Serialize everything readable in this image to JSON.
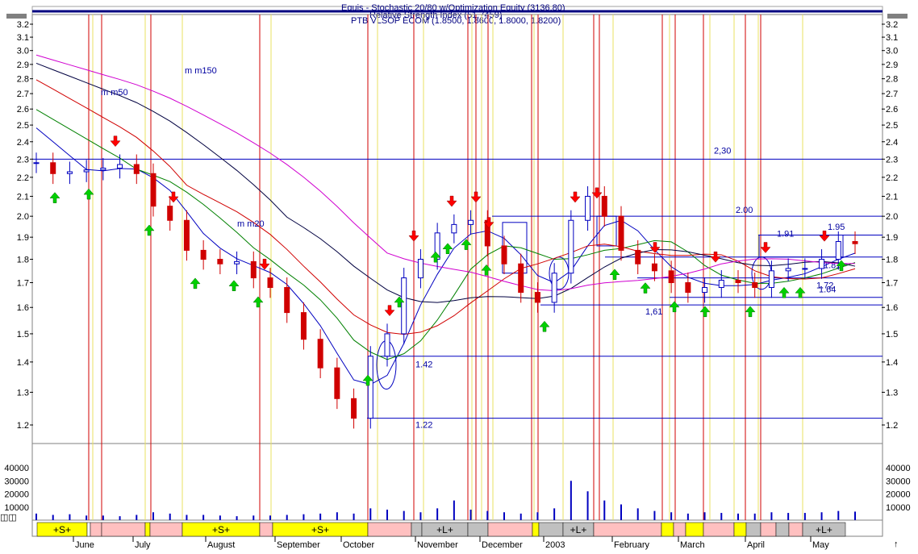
{
  "chart_data": {
    "type": "candlestick",
    "header": {
      "line1": "Equis - Stochastic 20/80 w/Optimization Equity (3136.80)",
      "line2": "Relative Strength Index (51.7459)",
      "line3": "PTB VLSOP ECOM (1.8500, 1.8600, 1.8000, 1.8200)"
    },
    "x_labels": [
      "June",
      "July",
      "August",
      "September",
      "October",
      "November",
      "December",
      "2003",
      "February",
      "March",
      "April",
      "May"
    ],
    "price_axis": {
      "ticks": [
        "3.2",
        "3.1",
        "3.0",
        "2.9",
        "2.8",
        "2.7",
        "2.6",
        "2.5",
        "2.4",
        "2.3",
        "2.2",
        "2.1",
        "2.0",
        "1.9",
        "1.8",
        "1.7",
        "1.6",
        "1.5",
        "1.4",
        "1.3",
        "1.2"
      ],
      "min": 1.15,
      "max": 3.25,
      "scale": "log"
    },
    "volume_axis": {
      "ticks": [
        "40000",
        "30000",
        "20000",
        "10000"
      ],
      "max": 45000
    },
    "horizontal_levels": [
      {
        "value": 2.3,
        "label": "2,30"
      },
      {
        "value": 2.0,
        "label": "2.00"
      },
      {
        "value": 1.91,
        "label": "1.91"
      },
      {
        "value": 1.81,
        "label": "1.81"
      },
      {
        "value": 1.72,
        "label": "1.72"
      },
      {
        "value": 1.64,
        "label": "1.64"
      },
      {
        "value": 1.61,
        "label": "1,61"
      },
      {
        "value": 1.42,
        "label": "1.42"
      },
      {
        "value": 1.22,
        "label": "1.22"
      }
    ],
    "level_1_95_label": "1.95",
    "ma_labels": {
      "mm150": "m m150",
      "mm50": "m m50",
      "mm20": "m m20"
    },
    "band_labels": [
      "+S+",
      "+S+",
      "+S+",
      "+L+",
      "+L+",
      "+L+"
    ],
    "dates": [
      "2002-06-03",
      "2002-06-10",
      "2002-06-17",
      "2002-06-24",
      "2002-07-01",
      "2002-07-08",
      "2002-07-15",
      "2002-07-22",
      "2002-07-29",
      "2002-08-05",
      "2002-08-12",
      "2002-08-19",
      "2002-08-26",
      "2002-09-02",
      "2002-09-09",
      "2002-09-16",
      "2002-09-23",
      "2002-09-30",
      "2002-10-07",
      "2002-10-14",
      "2002-10-21",
      "2002-10-28",
      "2002-11-04",
      "2002-11-11",
      "2002-11-18",
      "2002-11-25",
      "2002-12-02",
      "2002-12-09",
      "2002-12-16",
      "2002-12-23",
      "2002-12-30",
      "2003-01-06",
      "2003-01-13",
      "2003-01-20",
      "2003-01-27",
      "2003-02-03",
      "2003-02-10",
      "2003-02-17",
      "2003-02-24",
      "2003-03-03",
      "2003-03-10",
      "2003-03-17",
      "2003-03-24",
      "2003-03-31",
      "2003-04-07",
      "2003-04-14",
      "2003-04-21",
      "2003-04-28",
      "2003-05-05",
      "2003-05-12"
    ],
    "close": [
      2.28,
      2.22,
      2.23,
      2.24,
      2.25,
      2.27,
      2.22,
      2.05,
      1.98,
      1.84,
      1.8,
      1.78,
      1.79,
      1.72,
      1.68,
      1.58,
      1.48,
      1.38,
      1.28,
      1.22,
      1.42,
      1.5,
      1.72,
      1.8,
      1.92,
      1.96,
      1.98,
      1.86,
      1.78,
      1.66,
      1.62,
      1.74,
      1.98,
      2.1,
      2.0,
      1.84,
      1.78,
      1.75,
      1.7,
      1.66,
      1.68,
      1.71,
      1.7,
      1.68,
      1.75,
      1.76,
      1.76,
      1.8,
      1.88,
      1.87
    ],
    "volume": [
      5000,
      4000,
      4500,
      3500,
      3500,
      3000,
      4000,
      6000,
      5000,
      4000,
      4000,
      3500,
      3000,
      3500,
      3500,
      4000,
      4500,
      5000,
      6000,
      5000,
      9000,
      8000,
      7000,
      6000,
      9000,
      15000,
      8000,
      7000,
      6000,
      5000,
      6000,
      9000,
      30000,
      22000,
      15000,
      12000,
      9000,
      7000,
      6000,
      5000,
      6000,
      5500,
      5000,
      5000,
      6000,
      5500,
      5500,
      6000,
      7000,
      6500
    ],
    "red_signal_lines": [
      110,
      126,
      187,
      322,
      456,
      513,
      580,
      590,
      605,
      659,
      667,
      736,
      743,
      821,
      837,
      872,
      924,
      943
    ],
    "yellow_signal_lines": [
      115,
      180,
      226,
      336,
      468,
      525,
      585,
      597,
      611,
      662,
      698,
      760,
      830,
      880,
      910,
      940,
      995
    ],
    "up_arrow_dates": [
      6,
      9,
      35,
      83,
      145,
      226,
      240,
      262,
      265,
      275,
      285,
      316,
      390,
      422,
      425,
      482,
      510,
      530,
      535,
      555,
      580,
      591,
      617,
      621,
      640,
      659
    ],
    "down_arrow_dates": [
      32,
      45,
      68,
      80,
      118,
      135,
      168,
      187,
      193,
      214,
      230,
      238,
      300,
      314,
      350,
      352,
      362,
      398,
      438,
      452,
      548,
      583
    ]
  }
}
